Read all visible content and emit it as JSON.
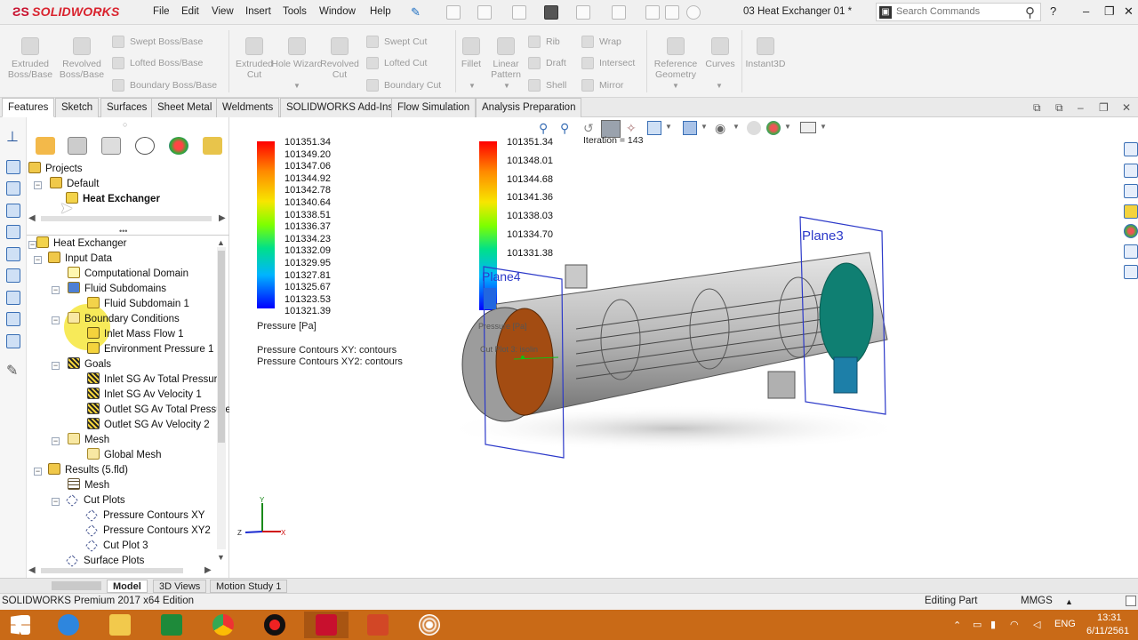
{
  "menubar": {
    "logo_text": "SOLIDWORKS",
    "menu": [
      "File",
      "Edit",
      "View",
      "Insert",
      "Tools",
      "Window",
      "Help"
    ],
    "document_title": "03 Heat Exchanger 01 *",
    "search_placeholder": "Search Commands"
  },
  "ribbon": {
    "big_buttons": [
      "Extruded Boss/Base",
      "Revolved Boss/Base",
      "Extruded Cut",
      "Hole Wizard",
      "Revolved Cut",
      "Fillet",
      "Linear Pattern",
      "Reference Geometry",
      "Curves",
      "Instant3D"
    ],
    "small_buttons": [
      "Swept Boss/Base",
      "Lofted Boss/Base",
      "Boundary Boss/Base",
      "Swept Cut",
      "Lofted Cut",
      "Boundary Cut",
      "Rib",
      "Draft",
      "Shell",
      "Wrap",
      "Intersect",
      "Mirror"
    ]
  },
  "tabs": [
    "Features",
    "Sketch",
    "Surfaces",
    "Sheet Metal",
    "Weldments",
    "SOLIDWORKS Add-Ins",
    "Flow Simulation",
    "Analysis Preparation"
  ],
  "project_tree": {
    "projects": "Projects",
    "default": "Default",
    "heat_exchanger": "Heat Exchanger"
  },
  "analysis_tree": {
    "root": "Heat Exchanger",
    "input_data": "Input Data",
    "computational_domain": "Computational Domain",
    "fluid_subdomains": "Fluid Subdomains",
    "fluid_subdomain_1": "Fluid Subdomain 1",
    "boundary_conditions": "Boundary Conditions",
    "inlet_mass_flow": "Inlet Mass Flow 1",
    "environment_pressure": "Environment Pressure 1",
    "goals": "Goals",
    "goal_1": "Inlet SG Av Total Pressure",
    "goal_2": "Inlet SG Av Velocity 1",
    "goal_3": "Outlet SG Av Total Pressure",
    "goal_4": "Outlet SG Av Velocity 2",
    "mesh": "Mesh",
    "global_mesh": "Global Mesh",
    "results": "Results (5.fld)",
    "results_mesh": "Mesh",
    "cut_plots": "Cut Plots",
    "cut_1": "Pressure Contours XY",
    "cut_2": "Pressure Contours XY2",
    "cut_3": "Cut Plot 3",
    "surface_plots": "Surface Plots"
  },
  "viewport": {
    "legend_left": [
      "101351.34",
      "101349.20",
      "101347.06",
      "101344.92",
      "101342.78",
      "101340.64",
      "101338.51",
      "101336.37",
      "101334.23",
      "101332.09",
      "101329.95",
      "101327.81",
      "101325.67",
      "101323.53",
      "101321.39"
    ],
    "legend_right": [
      "101351.34",
      "101348.01",
      "101344.68",
      "101341.36",
      "101338.03",
      "101334.70",
      "101331.38"
    ],
    "legend_unit": "Pressure [Pa]",
    "contour_1": "Pressure Contours XY: contours",
    "contour_2": "Pressure Contours XY2: contours",
    "iteration": "Iteration = 143",
    "plane_3": "Plane3",
    "plane_4": "Plane4",
    "plane_label_small": "Pressure [Pa]",
    "cut_label_small": "Cut Plot 3: isolin"
  },
  "bottom_tabs": [
    "Model",
    "3D Views",
    "Motion Study 1"
  ],
  "status": {
    "edition": "SOLIDWORKS Premium 2017 x64 Edition",
    "mode": "Editing Part",
    "units": "MMGS"
  },
  "taskbar": {
    "lang": "ENG",
    "time": "13:31",
    "date": "6/11/2561"
  },
  "colors": {
    "brand": "#d9232e",
    "taskbar": "#c96a17",
    "legend_gradient": [
      "#0000ff",
      "#00b4ff",
      "#00ff60",
      "#cfff00",
      "#ff9900",
      "#ff0000"
    ]
  }
}
